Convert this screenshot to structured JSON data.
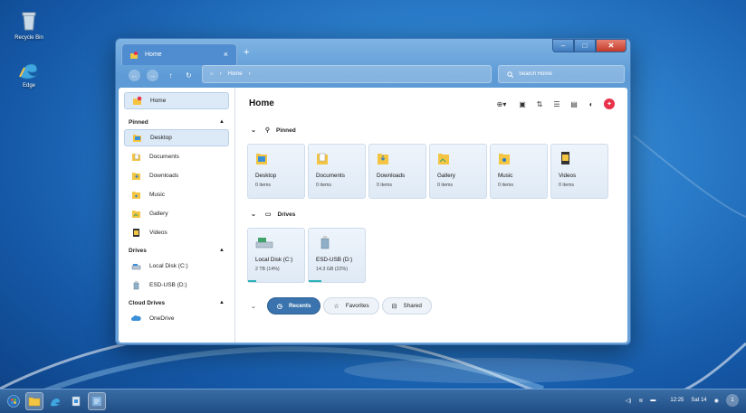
{
  "desktop": {
    "icons": [
      {
        "label": "Recycle Bin",
        "icon": "recycle-bin-icon"
      },
      {
        "label": "Edge",
        "icon": "edge-icon"
      }
    ]
  },
  "window": {
    "tab_title": "Home",
    "tab_close": "×",
    "new_tab": "+",
    "controls": {
      "minimize": "–",
      "maximize": "□",
      "close": "✕"
    },
    "breadcrumb": {
      "home_icon": "⌂",
      "separator": "›",
      "item": "Home",
      "trail": "›"
    },
    "search_placeholder": "Search Home"
  },
  "sidebar": {
    "home": "Home",
    "sections": {
      "pinned": "Pinned",
      "drives": "Drives",
      "cloud": "Cloud Drives"
    },
    "pinned": [
      "Desktop",
      "Documents",
      "Downloads",
      "Music",
      "Gallery",
      "Videos"
    ],
    "drives": [
      "Local Disk (C:)",
      "ESD-USB (D:)"
    ],
    "cloud": [
      "OneDrive"
    ]
  },
  "main": {
    "title": "Home",
    "pinned_label": "Pinned",
    "drives_label": "Drives",
    "pinned_cards": [
      {
        "name": "Desktop",
        "sub": "0 items"
      },
      {
        "name": "Documents",
        "sub": "0 items"
      },
      {
        "name": "Downloads",
        "sub": "0 items"
      },
      {
        "name": "Gallery",
        "sub": "0 items"
      },
      {
        "name": "Music",
        "sub": "0 items"
      },
      {
        "name": "Videos",
        "sub": "0 items"
      }
    ],
    "drive_cards": [
      {
        "name": "Local Disk (C:)",
        "sub": "2 TB (14%)",
        "used_fraction": 0.14
      },
      {
        "name": "ESD-USB (D:)",
        "sub": "14.3 GB (22%)",
        "used_fraction": 0.22
      }
    ],
    "pills": {
      "recents": "Recents",
      "favorites": "Favorites",
      "shared": "Shared"
    }
  },
  "taskbar": {
    "time": "12:25",
    "date": "Sat 14",
    "notifications": "1"
  },
  "colors": {
    "accent": "#3a73ad",
    "drive_bar": "#2cb3b8",
    "badge": "#e8324a"
  }
}
